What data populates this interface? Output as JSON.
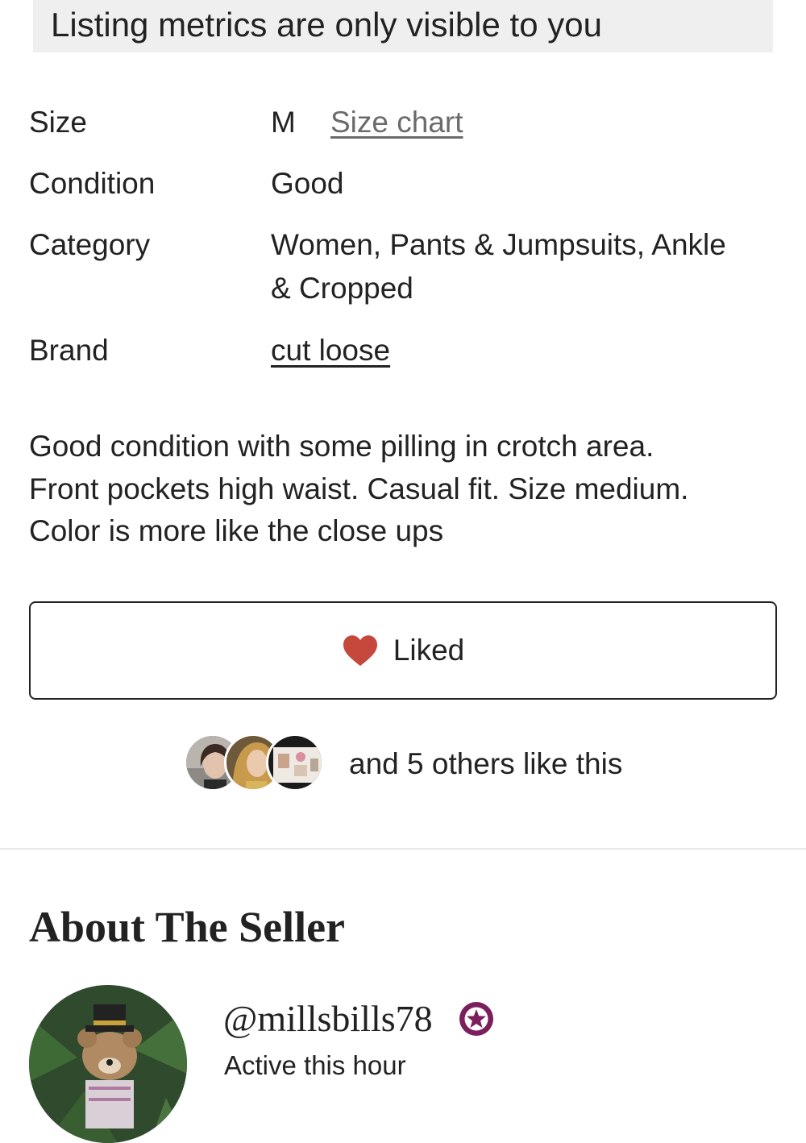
{
  "banner": {
    "text": "Listing metrics are only visible to you"
  },
  "details": {
    "size": {
      "label": "Size",
      "value": "M",
      "link": "Size chart"
    },
    "condition": {
      "label": "Condition",
      "value": "Good"
    },
    "category": {
      "label": "Category",
      "value_line1": "Women, Pants & Jumpsuits, Ankle",
      "value_line2": "& Cropped"
    },
    "brand": {
      "label": "Brand",
      "value": "cut loose"
    }
  },
  "description": {
    "line1": "Good condition with some pilling in crotch area.",
    "line2": "Front pockets high waist. Casual fit. Size medium.",
    "line3": "Color is more like the close ups"
  },
  "like_button": {
    "label": "Liked",
    "icon": "heart-icon",
    "color": "#c6473b"
  },
  "likes": {
    "text": "and 5 others like this"
  },
  "seller_section": {
    "title": "About The Seller",
    "username": "@millsbills78",
    "badge_icon": "star-badge-icon",
    "badge_color": "#7a1f5c",
    "status": "Active this hour"
  }
}
